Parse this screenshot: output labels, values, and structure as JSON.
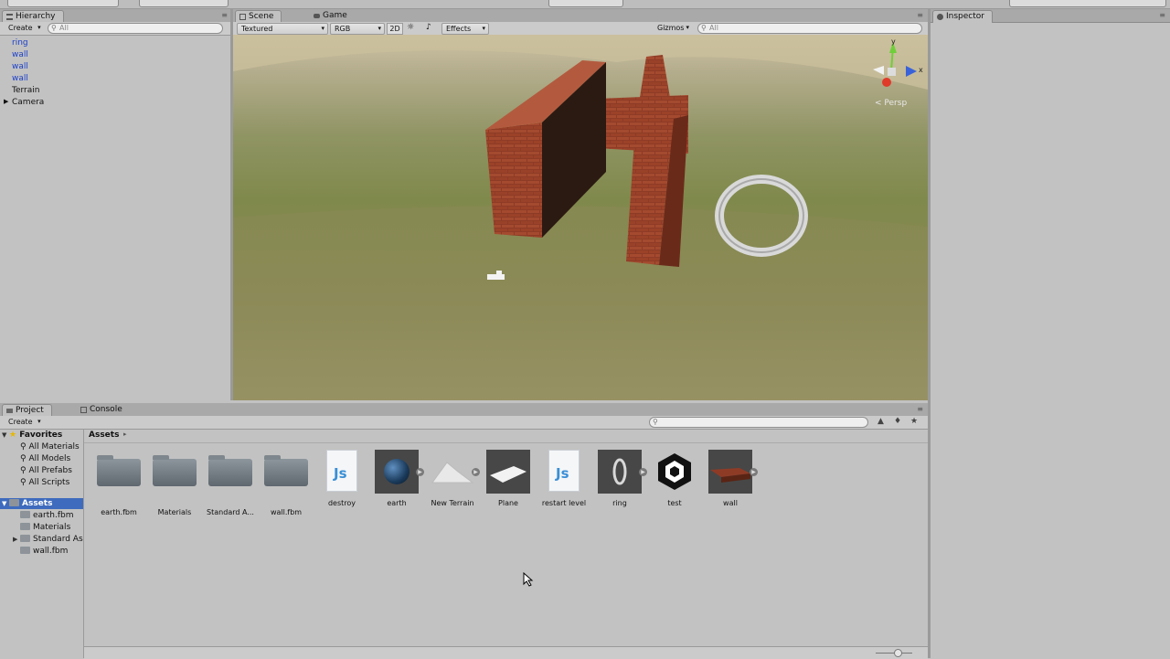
{
  "hierarchy": {
    "tab": "Hierarchy",
    "create": "Create",
    "search_placeholder": "All",
    "items": [
      "ring",
      "wall",
      "wall",
      "wall",
      "Terrain",
      "Camera"
    ]
  },
  "scene": {
    "tabs": [
      "Scene",
      "Game"
    ],
    "shading": "Textured",
    "render_mode": "RGB",
    "mode_2d": "2D",
    "effects": "Effects",
    "gizmos": "Gizmos",
    "search_placeholder": "All",
    "persp_label": "Persp",
    "axis_y": "y",
    "axis_x": "x"
  },
  "inspector": {
    "tab": "Inspector"
  },
  "project": {
    "tabs": [
      "Project",
      "Console"
    ],
    "create": "Create",
    "breadcrumb": "Assets",
    "favorites_label": "Favorites",
    "favorites": [
      "All Materials",
      "All Models",
      "All Prefabs",
      "All Scripts"
    ],
    "assets_label": "Assets",
    "assets_tree": [
      "earth.fbm",
      "Materials",
      "Standard As",
      "wall.fbm"
    ],
    "assets": [
      {
        "name": "earth.fbm",
        "kind": "folder"
      },
      {
        "name": "Materials",
        "kind": "folder"
      },
      {
        "name": "Standard A...",
        "kind": "folder"
      },
      {
        "name": "wall.fbm",
        "kind": "folder"
      },
      {
        "name": "destroy",
        "kind": "script"
      },
      {
        "name": "earth",
        "kind": "model-earth"
      },
      {
        "name": "New Terrain",
        "kind": "terrain"
      },
      {
        "name": "Plane",
        "kind": "plane"
      },
      {
        "name": "restart level",
        "kind": "script"
      },
      {
        "name": "ring",
        "kind": "ring"
      },
      {
        "name": "test",
        "kind": "unity-scene"
      },
      {
        "name": "wall",
        "kind": "model-wall"
      }
    ]
  },
  "colors": {
    "selected_tab": "#c2c2c2",
    "hierarchy_blue": "#1b3fc9",
    "sky": "#b9b08f",
    "ground": "#7f8b4a"
  }
}
